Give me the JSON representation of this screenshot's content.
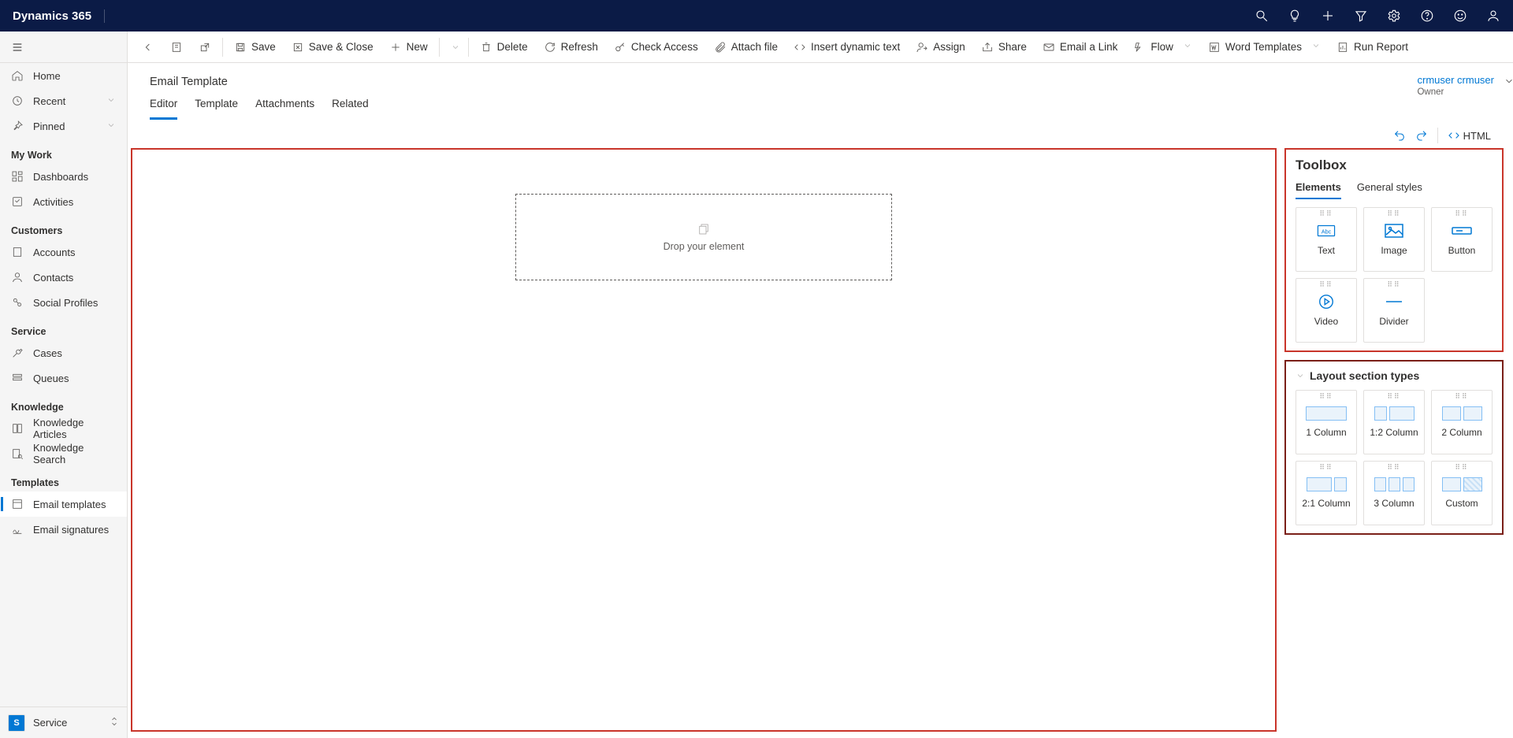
{
  "header": {
    "brand": "Dynamics 365"
  },
  "sidebar": {
    "top": [
      {
        "label": "Home"
      },
      {
        "label": "Recent"
      },
      {
        "label": "Pinned"
      }
    ],
    "sections": [
      {
        "title": "My Work",
        "items": [
          {
            "label": "Dashboards"
          },
          {
            "label": "Activities"
          }
        ]
      },
      {
        "title": "Customers",
        "items": [
          {
            "label": "Accounts"
          },
          {
            "label": "Contacts"
          },
          {
            "label": "Social Profiles"
          }
        ]
      },
      {
        "title": "Service",
        "items": [
          {
            "label": "Cases"
          },
          {
            "label": "Queues"
          }
        ]
      },
      {
        "title": "Knowledge",
        "items": [
          {
            "label": "Knowledge Articles"
          },
          {
            "label": "Knowledge Search"
          }
        ]
      },
      {
        "title": "Templates",
        "items": [
          {
            "label": "Email templates"
          },
          {
            "label": "Email signatures"
          }
        ]
      }
    ],
    "area": {
      "initial": "S",
      "label": "Service"
    }
  },
  "cmdbar": {
    "save": "Save",
    "saveclose": "Save & Close",
    "new": "New",
    "delete": "Delete",
    "refresh": "Refresh",
    "checkaccess": "Check Access",
    "attach": "Attach file",
    "dynamictext": "Insert dynamic text",
    "assign": "Assign",
    "share": "Share",
    "emaillink": "Email a Link",
    "flow": "Flow",
    "wordtemplates": "Word Templates",
    "runreport": "Run Report"
  },
  "record": {
    "title": "Email Template",
    "owner_name": "crmuser crmuser",
    "owner_label": "Owner"
  },
  "tabs": {
    "editor": "Editor",
    "template": "Template",
    "attachments": "Attachments",
    "related": "Related"
  },
  "sec_toolbar": {
    "html": "HTML"
  },
  "canvas": {
    "drop_hint": "Drop your element"
  },
  "toolbox": {
    "title": "Toolbox",
    "tab_elements": "Elements",
    "tab_styles": "General styles",
    "elements": {
      "text": "Text",
      "image": "Image",
      "button": "Button",
      "video": "Video",
      "divider": "Divider"
    },
    "layout_title": "Layout section types",
    "layouts": {
      "one": "1 Column",
      "onetwo": "1:2 Column",
      "two": "2 Column",
      "twoone": "2:1 Column",
      "three": "3 Column",
      "custom": "Custom"
    }
  }
}
